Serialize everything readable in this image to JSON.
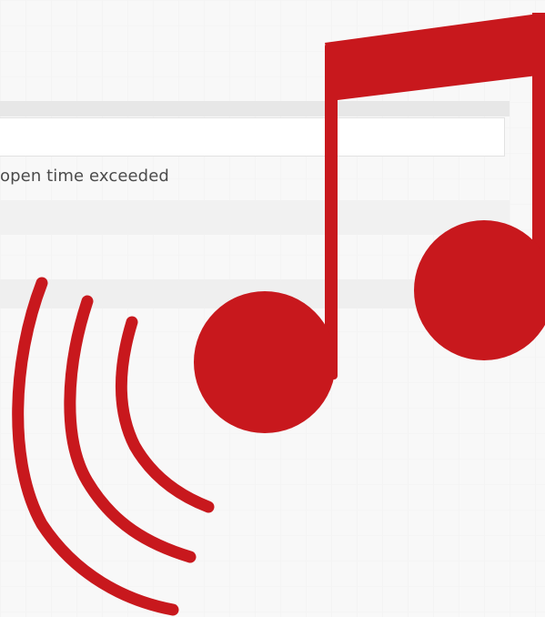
{
  "status": {
    "text": "open time exceeded"
  },
  "overlay": {
    "icon_name": "music-notes-with-sound-waves-icon",
    "color": "#c8181d"
  }
}
